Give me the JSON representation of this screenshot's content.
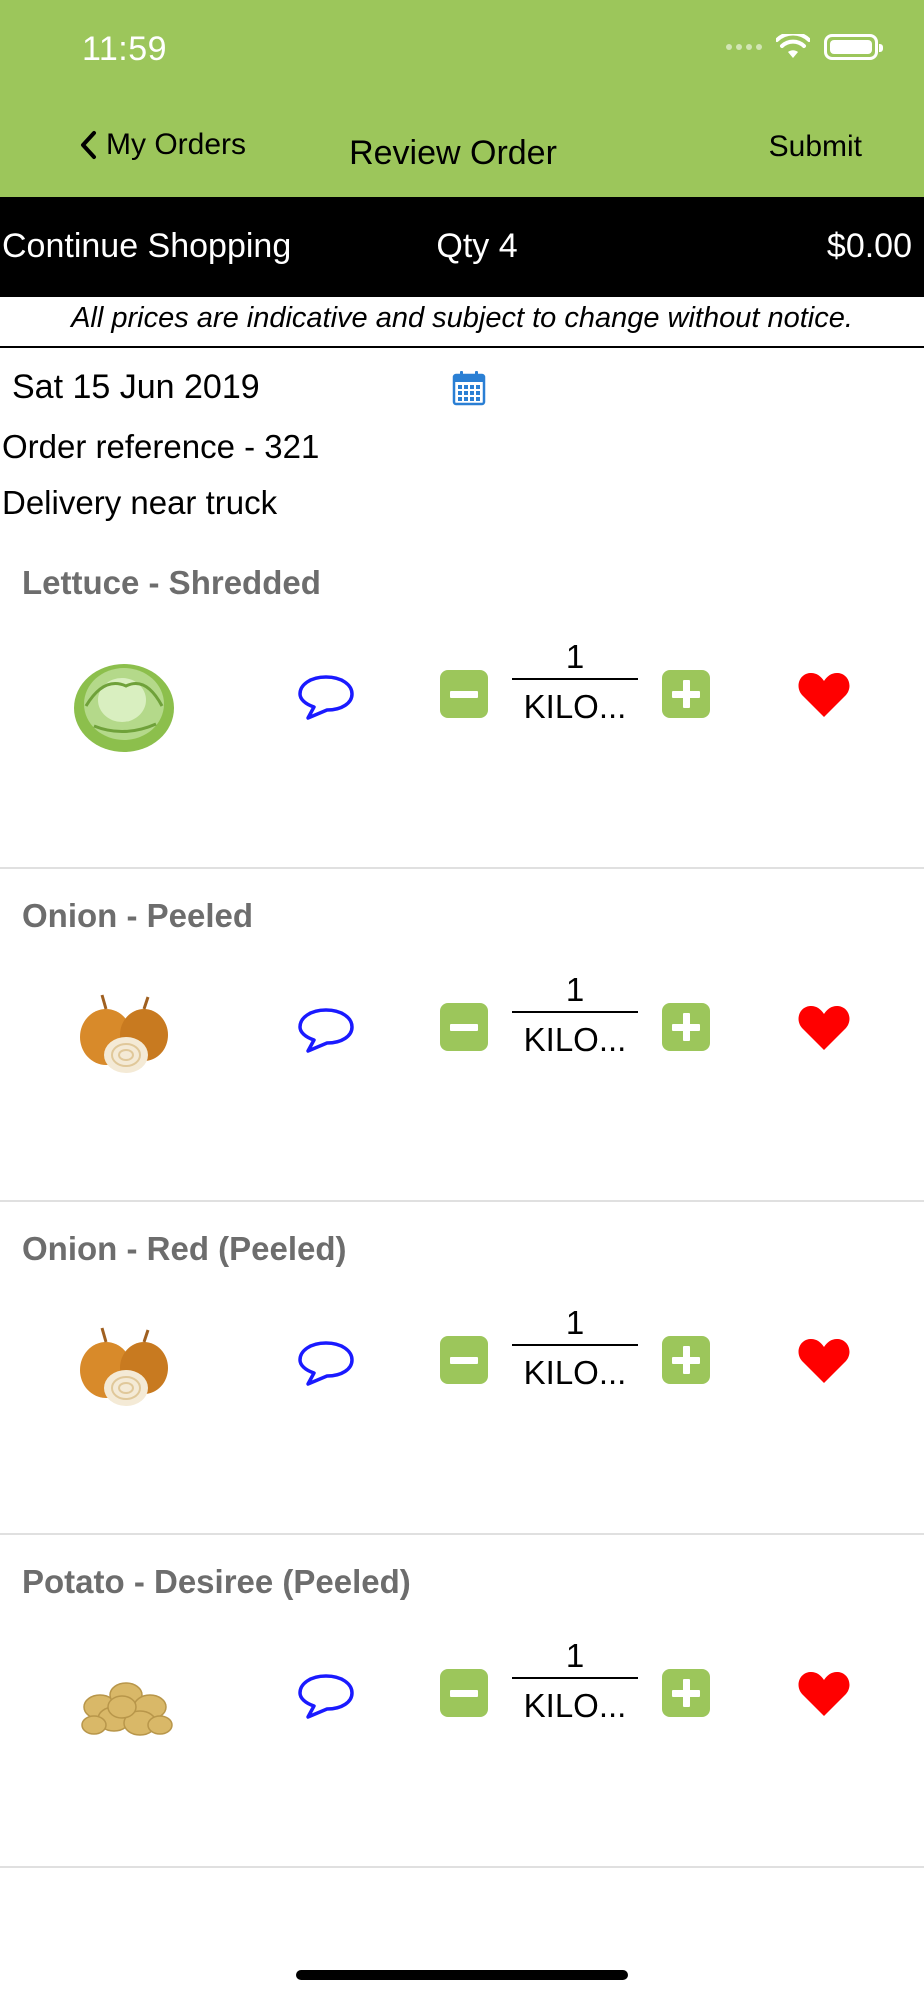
{
  "status_bar": {
    "time": "11:59"
  },
  "nav": {
    "back_label": "My Orders",
    "title": "Review Order",
    "submit_label": "Submit"
  },
  "cart_bar": {
    "continue_label": "Continue Shopping",
    "qty_label": "Qty 4",
    "total": "$0.00"
  },
  "notice": "All prices are indicative and subject to change without notice.",
  "order": {
    "date": "Sat 15 Jun 2019",
    "reference": "Order reference - 321",
    "delivery": "Delivery near truck"
  },
  "items": [
    {
      "name": "Lettuce - Shredded",
      "qty": "1",
      "unit": "KILO...",
      "image": "lettuce"
    },
    {
      "name": "Onion - Peeled",
      "qty": "1",
      "unit": "KILO...",
      "image": "onion"
    },
    {
      "name": "Onion - Red (Peeled)",
      "qty": "1",
      "unit": "KILO...",
      "image": "onion"
    },
    {
      "name": "Potato - Desiree (Peeled)",
      "qty": "1",
      "unit": "KILO...",
      "image": "potato"
    }
  ],
  "colors": {
    "header": "#9cc65b",
    "accent_green": "#9cc65b",
    "comment_blue": "#1a1aff",
    "heart_red": "#ff0000",
    "calendar_blue": "#2a7fd4"
  },
  "icons": {
    "back": "chevron-left-icon",
    "calendar": "calendar-icon",
    "comment": "speech-bubble-icon",
    "favorite": "heart-icon"
  }
}
